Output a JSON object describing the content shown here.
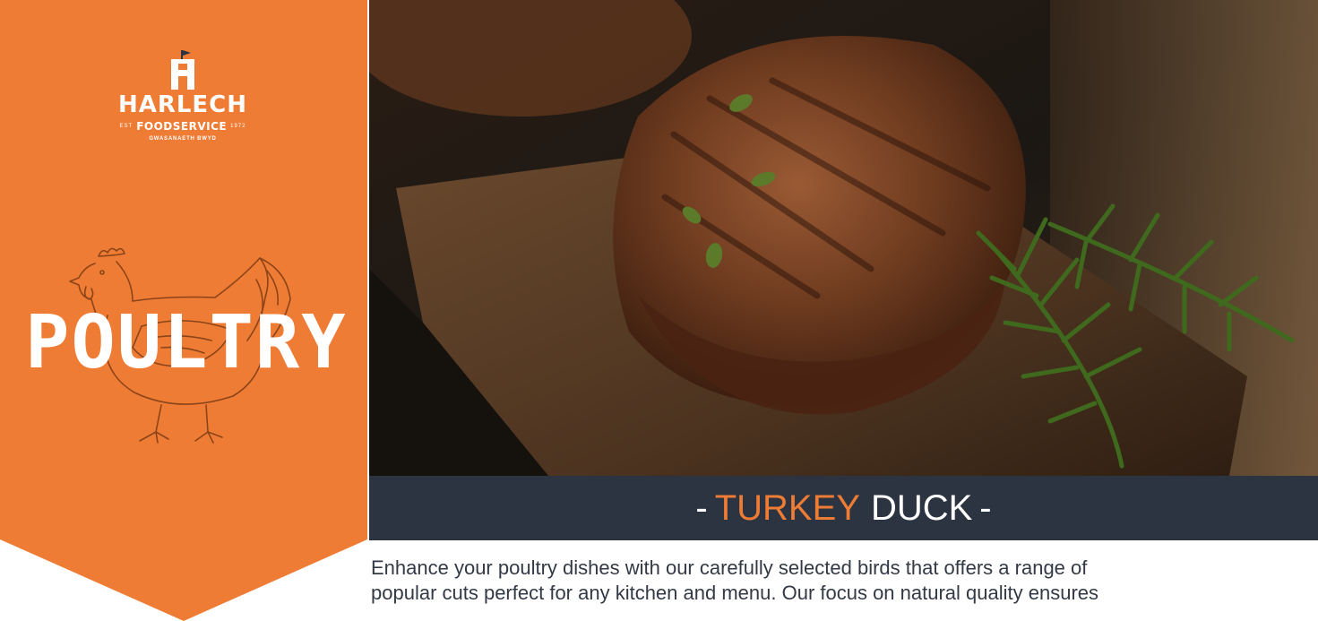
{
  "brand": {
    "name": "HARLECH",
    "subtitle": "FOODSERVICE",
    "est": "EST",
    "year": "1972",
    "welsh": "GWASANAETH BWYD"
  },
  "category": {
    "title": "POULTRY",
    "icon": "hen-icon"
  },
  "hero": {
    "subject": "grilled duck breast with rosemary on board"
  },
  "products": {
    "dash_left": "-",
    "item1": "TURKEY",
    "item2": "DUCK",
    "dash_right": "-"
  },
  "intro": {
    "line1": "Enhance your poultry dishes with our carefully selected birds that offers a range of",
    "line2": "popular cuts perfect for any kitchen and menu. Our focus on natural quality ensures"
  },
  "colors": {
    "orange": "#ef7c35",
    "navy": "#2b3440",
    "text": "#333a45"
  }
}
